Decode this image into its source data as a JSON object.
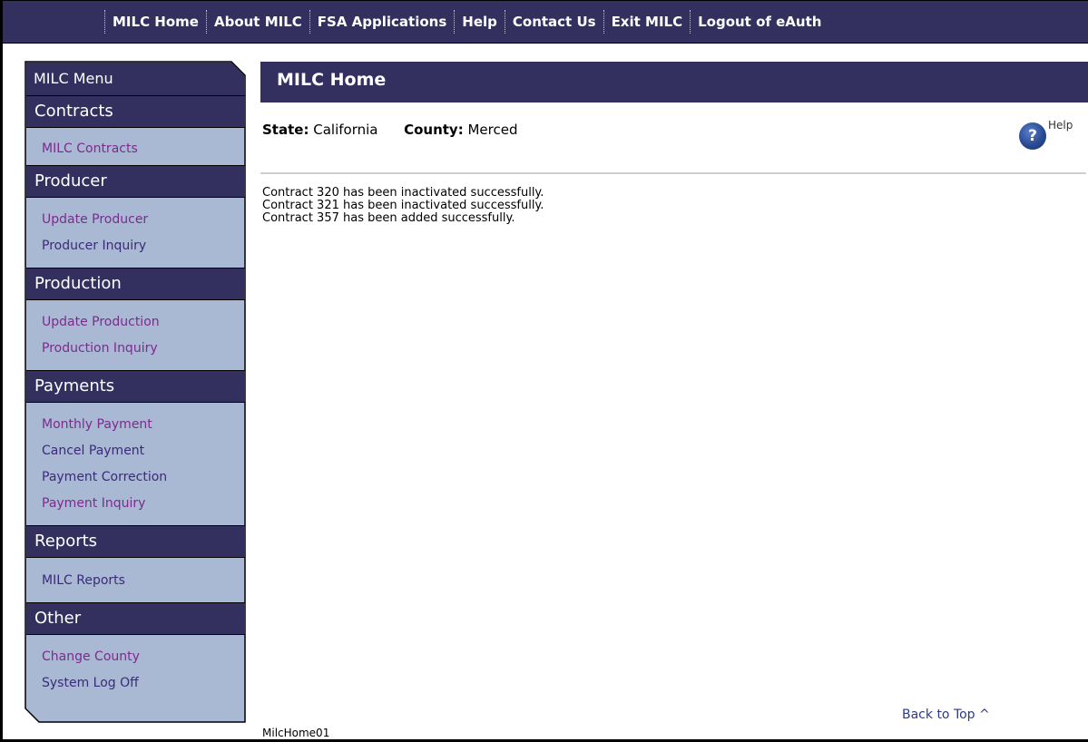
{
  "topnav": {
    "items": [
      "MILC Home",
      "About MILC",
      "FSA Applications",
      "Help",
      "Contact Us",
      "Exit MILC",
      "Logout of eAuth"
    ]
  },
  "sidebar": {
    "title": "MILC Menu",
    "sections": [
      {
        "header": "Contracts",
        "links": [
          "MILC Contracts"
        ]
      },
      {
        "header": "Producer",
        "links": [
          "Update Producer",
          "Producer Inquiry"
        ]
      },
      {
        "header": "Production",
        "links": [
          "Update Production",
          "Production Inquiry"
        ]
      },
      {
        "header": "Payments",
        "links": [
          "Monthly Payment",
          "Cancel Payment",
          "Payment Correction",
          "Payment Inquiry"
        ]
      },
      {
        "header": "Reports",
        "links": [
          "MILC Reports"
        ]
      },
      {
        "header": "Other",
        "links": [
          "Change County",
          "System Log Off"
        ]
      }
    ]
  },
  "main": {
    "title": "MILC Home",
    "state_label": "State:",
    "state_value": "California",
    "county_label": "County:",
    "county_value": "Merced",
    "help_icon_glyph": "?",
    "help_label": "Help",
    "messages": [
      "Contract 320 has been inactivated successfully.",
      "Contract 321 has been inactivated successfully.",
      "Contract 357 has been added successfully."
    ],
    "back_to_top": "Back to Top ^",
    "page_id": "MilcHome01"
  },
  "colors": {
    "nav_bg": "#33305f",
    "sidebar_bg": "#a9b8d3",
    "link_purple": "#7b2c8c",
    "link_blue": "#3a2b7a"
  }
}
